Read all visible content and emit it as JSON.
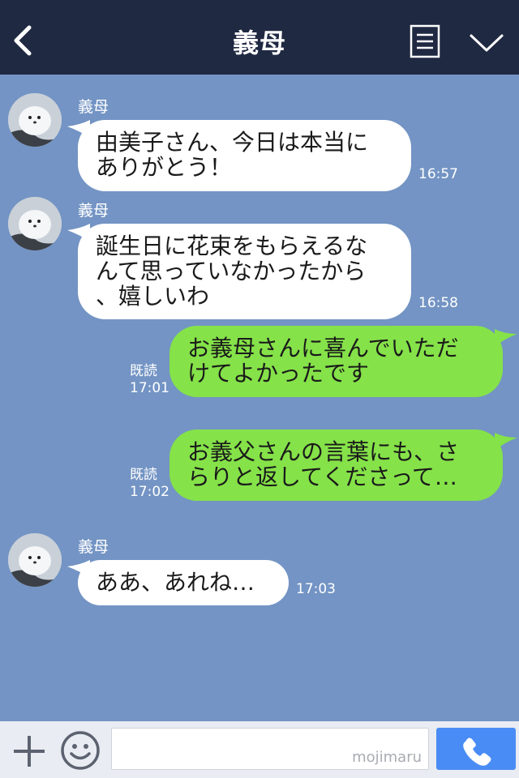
{
  "header": {
    "title": "義母"
  },
  "messages": [
    {
      "sender": "義母",
      "text": "由美子さん、今日は本当に\nありがとう！",
      "time": "16:57"
    },
    {
      "sender": "義母",
      "text": "誕生日に花束をもらえるな\nんて思っていなかったから\n、嬉しいわ",
      "time": "16:58"
    },
    {
      "text": "お義母さんに喜んでいただ\nけてよかったです",
      "read": "既読",
      "time": "17:01"
    },
    {
      "text": "お義父さんの言葉にも、さ\nらりと返してくださって…",
      "read": "既読",
      "time": "17:02"
    },
    {
      "sender": "義母",
      "text": "ああ、あれね…",
      "time": "17:03"
    }
  ],
  "footer": {
    "watermark": "mojimaru"
  },
  "colors": {
    "header_bg": "#1f2942",
    "chat_bg": "#7394c4",
    "incoming_bubble": "#ffffff",
    "outgoing_bubble": "#85e249",
    "call_button": "#4a8cf5"
  },
  "icons": [
    "back-arrow-icon",
    "menu-icon",
    "chevron-down-icon",
    "plus-icon",
    "emoji-icon",
    "phone-icon"
  ]
}
